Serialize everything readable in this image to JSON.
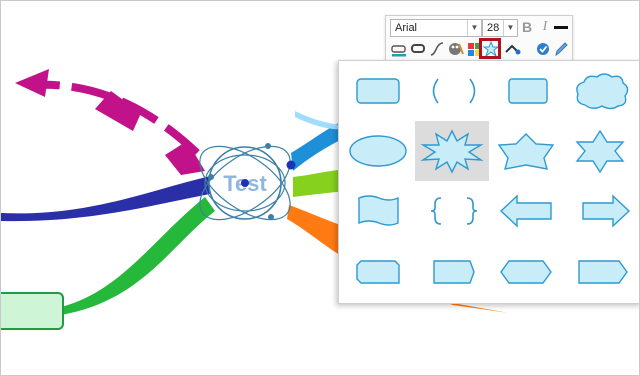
{
  "toolbar": {
    "font_family": "Arial",
    "font_size": "28",
    "bold_label": "B",
    "italic_label": "I",
    "icons": [
      "text-style-icon",
      "box-style-icon",
      "line-style-icon",
      "color-palette-icon",
      "color-grid-icon",
      "shape-icon",
      "shape-dropdown-icon",
      "checkmark-icon",
      "pencil-icon"
    ]
  },
  "topic": {
    "label": "Test"
  },
  "palette": {
    "rows": [
      [
        "rounded-rectangle",
        "brackets",
        "rounded-square",
        "cloud"
      ],
      [
        "ellipse",
        "starburst",
        "pentagon-star",
        "six-point-star"
      ],
      [
        "wave-banner",
        "curly-braces",
        "left-arrow",
        "right-arrow"
      ],
      [
        "snipped-rectangle",
        "home-plate",
        "hexagon-tab",
        "pointed-tab"
      ]
    ],
    "selected": "starburst"
  },
  "colors": {
    "shape_fill": "#c8ecf8",
    "shape_stroke": "#2e9ad0",
    "highlight": "#b3111b",
    "magenta_branch": "#c2128a",
    "navy_branch": "#2a2fa8",
    "green_branch": "#25b83a",
    "sky_branch": "#1e90d8",
    "lime_branch": "#86d11e",
    "orange_branch": "#ff7a12",
    "node_fill": "#cdf5d6",
    "node_stroke": "#1f9d45",
    "topic_text": "#8fb6dc"
  }
}
